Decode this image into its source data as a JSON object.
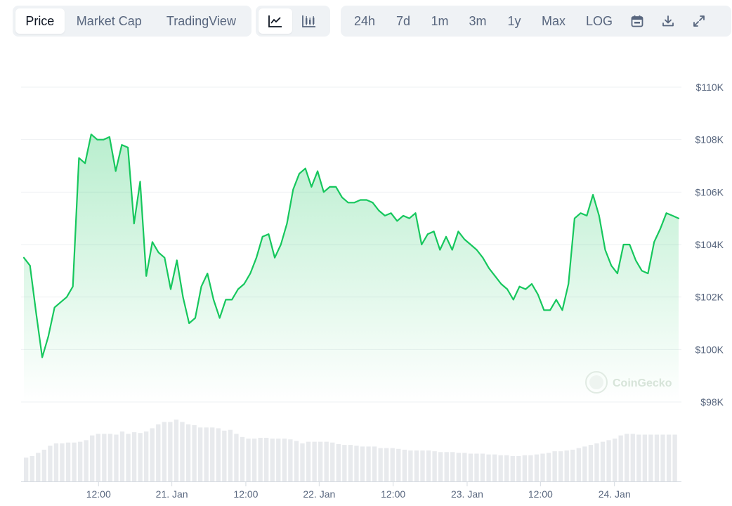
{
  "tabs": [
    {
      "label": "Price",
      "active": true
    },
    {
      "label": "Market Cap",
      "active": false
    },
    {
      "label": "TradingView",
      "active": false
    }
  ],
  "chart_types": [
    {
      "icon": "line-chart-icon",
      "active": true
    },
    {
      "icon": "candlestick-chart-icon",
      "active": false
    }
  ],
  "ranges": [
    "24h",
    "7d",
    "1m",
    "3m",
    "1y",
    "Max",
    "LOG"
  ],
  "toolbar_icons": [
    "calendar-icon",
    "download-icon",
    "expand-icon"
  ],
  "watermark": "CoinGecko",
  "colors": {
    "line": "#16c75d",
    "area_top": "#c3ecd0",
    "volume": "#e8eaed",
    "grid": "#eef0f3"
  },
  "chart_data": {
    "type": "area",
    "y_tick_labels": [
      "$110K",
      "$108K",
      "$106K",
      "$104K",
      "$102K",
      "$100K",
      "$98K"
    ],
    "y_ticks": [
      110000,
      108000,
      106000,
      104000,
      102000,
      100000,
      98000
    ],
    "ylim": [
      98000,
      110000
    ],
    "x_tick_labels": [
      {
        "label": "12:00",
        "t": 0.114
      },
      {
        "label": "21. Jan",
        "t": 0.226
      },
      {
        "label": "12:00",
        "t": 0.339
      },
      {
        "label": "22. Jan",
        "t": 0.451
      },
      {
        "label": "12:00",
        "t": 0.564
      },
      {
        "label": "23. Jan",
        "t": 0.677
      },
      {
        "label": "12:00",
        "t": 0.789
      },
      {
        "label": "24. Jan",
        "t": 0.902
      }
    ],
    "grid": true,
    "price_series": {
      "name": "Price",
      "values": [
        103500,
        103200,
        101400,
        99700,
        100500,
        101600,
        101800,
        102000,
        102400,
        107300,
        107100,
        108200,
        108000,
        108000,
        108100,
        106800,
        107800,
        107700,
        104800,
        106400,
        102800,
        104100,
        103700,
        103500,
        102300,
        103400,
        102000,
        101000,
        101200,
        102400,
        102900,
        101900,
        101200,
        101900,
        101900,
        102300,
        102500,
        102900,
        103500,
        104300,
        104400,
        103500,
        104000,
        104800,
        106100,
        106700,
        106900,
        106200,
        106800,
        106000,
        106200,
        106200,
        105800,
        105600,
        105600,
        105700,
        105700,
        105600,
        105300,
        105100,
        105200,
        104900,
        105100,
        105000,
        105200,
        104000,
        104400,
        104500,
        103800,
        104300,
        103800,
        104500,
        104200,
        104000,
        103800,
        103500,
        103100,
        102800,
        102500,
        102300,
        101900,
        102400,
        102300,
        102500,
        102100,
        101500,
        101500,
        101900,
        101500,
        102500,
        105000,
        105200,
        105100,
        105900,
        105100,
        103800,
        103200,
        102900,
        104000,
        104000,
        103400,
        103000,
        102900,
        104100,
        104600,
        105200,
        105100,
        105000
      ]
    },
    "volume_series": {
      "values": [
        30,
        32,
        36,
        40,
        45,
        48,
        48,
        49,
        49,
        50,
        52,
        58,
        60,
        60,
        60,
        59,
        63,
        60,
        62,
        61,
        63,
        67,
        72,
        75,
        75,
        78,
        75,
        72,
        71,
        68,
        68,
        68,
        67,
        64,
        65,
        60,
        56,
        54,
        54,
        55,
        55,
        54,
        54,
        54,
        53,
        51,
        48,
        50,
        50,
        50,
        50,
        49,
        47,
        46,
        46,
        45,
        44,
        44,
        44,
        42,
        42,
        42,
        41,
        40,
        39,
        39,
        39,
        39,
        38,
        37,
        37,
        37,
        36,
        36,
        35,
        35,
        35,
        34,
        34,
        33,
        33,
        32,
        32,
        33,
        33,
        34,
        35,
        36,
        38,
        38,
        39,
        40,
        42,
        44,
        46,
        48,
        50,
        52,
        54,
        58,
        60,
        60,
        59,
        59,
        59,
        59,
        59,
        59,
        59
      ]
    }
  }
}
